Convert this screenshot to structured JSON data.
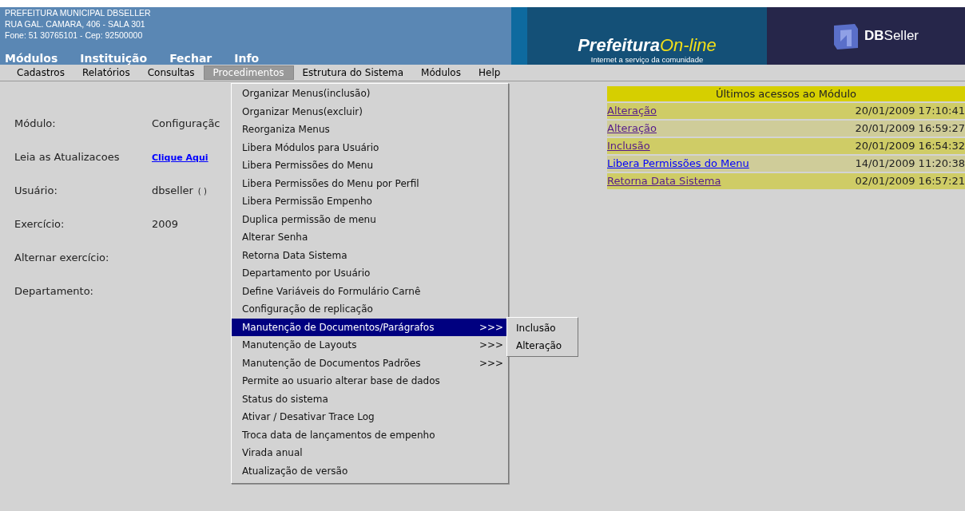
{
  "header": {
    "org_lines": [
      "PREFEITURA MUNICIPAL DBSELLER",
      "RUA GAL. CAMARA, 406 - SALA 301",
      "Fone: 51 30765101  -  Cep: 92500000"
    ],
    "top_menu": [
      "Módulos",
      "Instituição",
      "Fechar",
      "Info"
    ],
    "brand": {
      "title": "Prefeitura",
      "suffix": "On-line",
      "tagline": "Internet a serviço da comunidade"
    },
    "vendor": "**DB**Seller"
  },
  "menubar": [
    {
      "label": "Cadastros",
      "selected": false
    },
    {
      "label": "Relatórios",
      "selected": false
    },
    {
      "label": "Consultas",
      "selected": false
    },
    {
      "label": "Procedimentos",
      "selected": true
    },
    {
      "label": "Estrutura do Sistema",
      "selected": false
    },
    {
      "label": "Módulos",
      "selected": false
    },
    {
      "label": "Help",
      "selected": false
    }
  ],
  "info": [
    {
      "label": "Módulo:",
      "value": "Configuraçãc",
      "kind": "text"
    },
    {
      "label": "Leia as Atualizacoes",
      "value": "Clique Aqui",
      "kind": "link"
    },
    {
      "label": "Usuário:",
      "value": "dbseller",
      "extra": "( )",
      "kind": "text"
    },
    {
      "label": "Exercício:",
      "value": "2009",
      "kind": "text"
    },
    {
      "label": "Alternar exercício:"
    },
    {
      "label": "Departamento:"
    }
  ],
  "dropdown": [
    {
      "label": "Organizar Menus(inclusão)",
      "selected": false
    },
    {
      "label": "Organizar Menus(excluir)",
      "selected": false
    },
    {
      "label": "Reorganiza Menus",
      "selected": false
    },
    {
      "label": "Libera Módulos para Usuário",
      "selected": false
    },
    {
      "label": "Libera Permissões do Menu",
      "selected": false
    },
    {
      "label": "Libera Permissões do Menu por Perfil",
      "selected": false
    },
    {
      "label": "Libera Permissão Empenho",
      "selected": false
    },
    {
      "label": "Duplica permissão de menu",
      "selected": false
    },
    {
      "label": "Alterar Senha",
      "selected": false
    },
    {
      "label": "Retorna Data Sistema",
      "selected": false
    },
    {
      "label": "Departamento por Usuário",
      "selected": false
    },
    {
      "label": "Define Variáveis do Formulário Carnê",
      "selected": false
    },
    {
      "label": "Configuração de replicação",
      "selected": false
    },
    {
      "label": "Manutenção de Documentos/Parágrafos",
      "arrow": ">>>",
      "selected": true,
      "children": [
        {
          "label": "Inclusão"
        },
        {
          "label": "Alteração"
        }
      ]
    },
    {
      "label": "Manutenção de Layouts",
      "arrow": ">>>",
      "selected": false
    },
    {
      "label": "Manutenção de Documentos Padrões",
      "arrow": ">>>",
      "selected": false
    },
    {
      "label": "Permite ao usuario alterar base de dados",
      "selected": false
    },
    {
      "label": "Status do sistema",
      "selected": false
    },
    {
      "label": "Ativar / Desativar Trace Log",
      "selected": false
    },
    {
      "label": "Troca data de lançamentos de empenho",
      "selected": false
    },
    {
      "label": "Virada anual",
      "selected": false
    },
    {
      "label": "Atualização de versão",
      "selected": false
    }
  ],
  "recent": {
    "title": "Últimos acessos ao Módulo",
    "rows": [
      {
        "name": "Alteração",
        "date": "20/01/2009 17:10:41",
        "visited": true
      },
      {
        "name": "Alteração",
        "date": "20/01/2009 16:59:27",
        "visited": true
      },
      {
        "name": "Inclusão",
        "date": "20/01/2009 16:54:32",
        "visited": true
      },
      {
        "name": "Libera Permissões do Menu",
        "date": "14/01/2009 11:20:38",
        "visited": false
      },
      {
        "name": "Retorna Data Sistema",
        "date": "02/01/2009 16:57:21",
        "visited": true
      }
    ]
  }
}
